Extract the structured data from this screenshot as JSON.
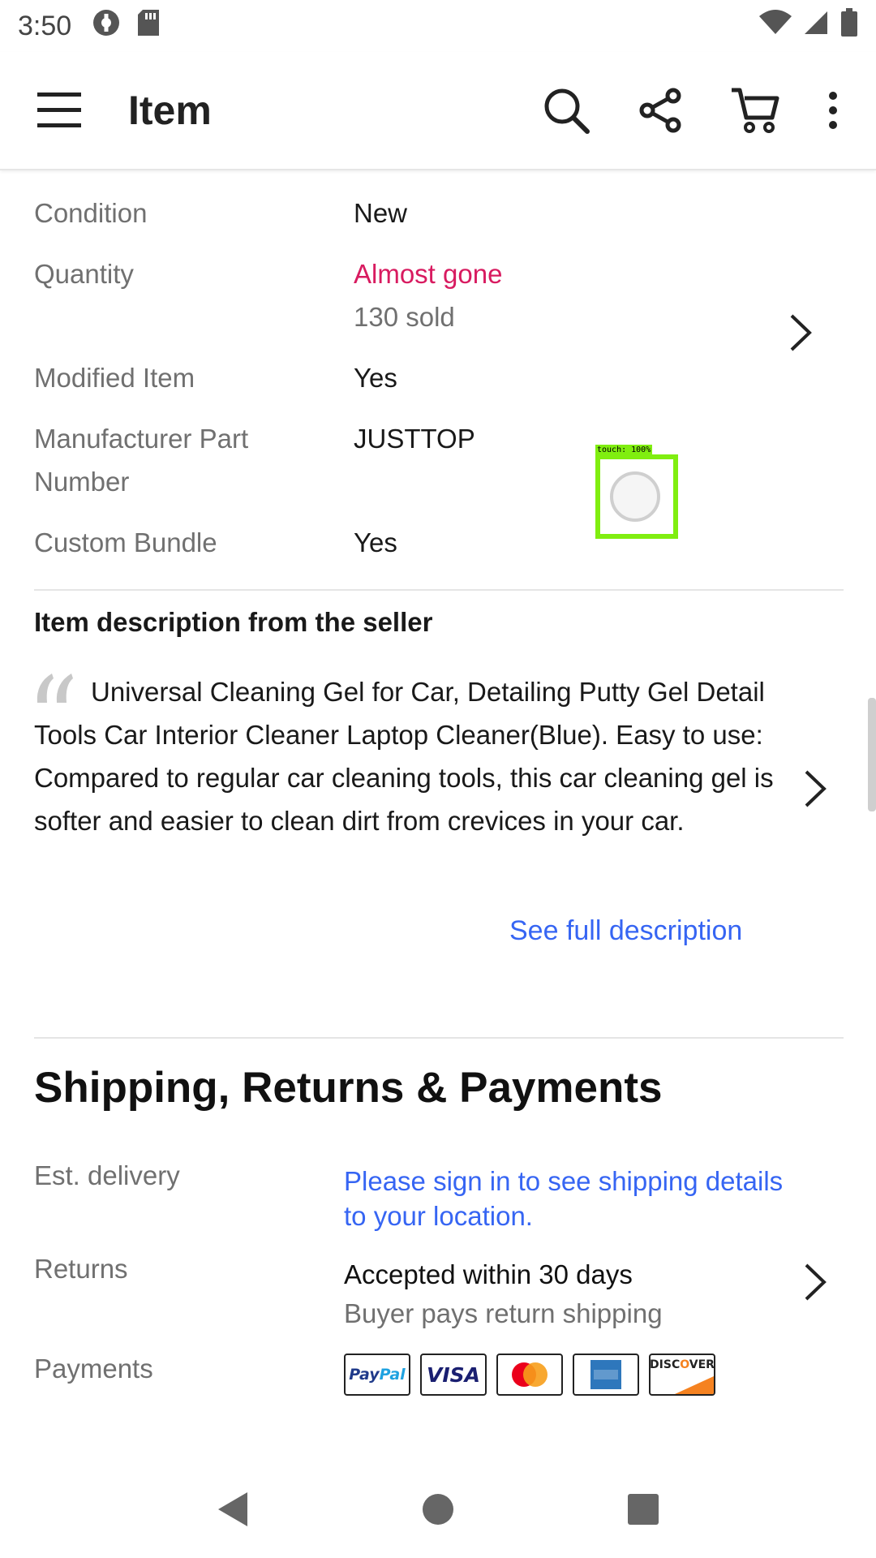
{
  "status_bar": {
    "time": "3:50",
    "icons": [
      "data-saver-icon",
      "sd-card-icon",
      "wifi-icon",
      "cell-signal-icon",
      "battery-icon"
    ]
  },
  "app_bar": {
    "title": "Item",
    "icons": [
      "menu-icon",
      "search-icon",
      "share-icon",
      "cart-icon",
      "more-vert-icon"
    ]
  },
  "specs": [
    {
      "key": "Condition",
      "value": "New"
    },
    {
      "key": "Quantity",
      "value": "Almost gone",
      "value_sub": "130 sold"
    },
    {
      "key": "Modified Item",
      "value": "Yes"
    },
    {
      "key": "Manufacturer Part Number",
      "value": "JUSTTOP"
    },
    {
      "key": "Custom Bundle",
      "value": "Yes"
    }
  ],
  "description": {
    "title": "Item description from the seller",
    "text": "Universal Cleaning Gel for Car, Detailing Putty Gel Detail Tools Car Interior Cleaner Laptop Cleaner(Blue). Easy to use: Compared to regular car cleaning tools, this car cleaning gel is softer and easier to clean dirt from crevices in your car.",
    "see_full": "See full description"
  },
  "shipping": {
    "heading": "Shipping, Returns & Payments",
    "est_delivery_label": "Est. delivery",
    "est_delivery_value": "Please sign in to see shipping details to your location.",
    "returns_label": "Returns",
    "returns_value": "Accepted within 30 days",
    "returns_sub": "Buyer pays return shipping",
    "payments_label": "Payments",
    "payment_methods": [
      "PayPal",
      "VISA",
      "MasterCard",
      "American Express",
      "DISCOVER"
    ]
  },
  "touch_overlay": {
    "label": "touch: 100%"
  },
  "colors": {
    "link": "#3665f3",
    "alert": "#d81b60",
    "touch": "#80ee10"
  }
}
